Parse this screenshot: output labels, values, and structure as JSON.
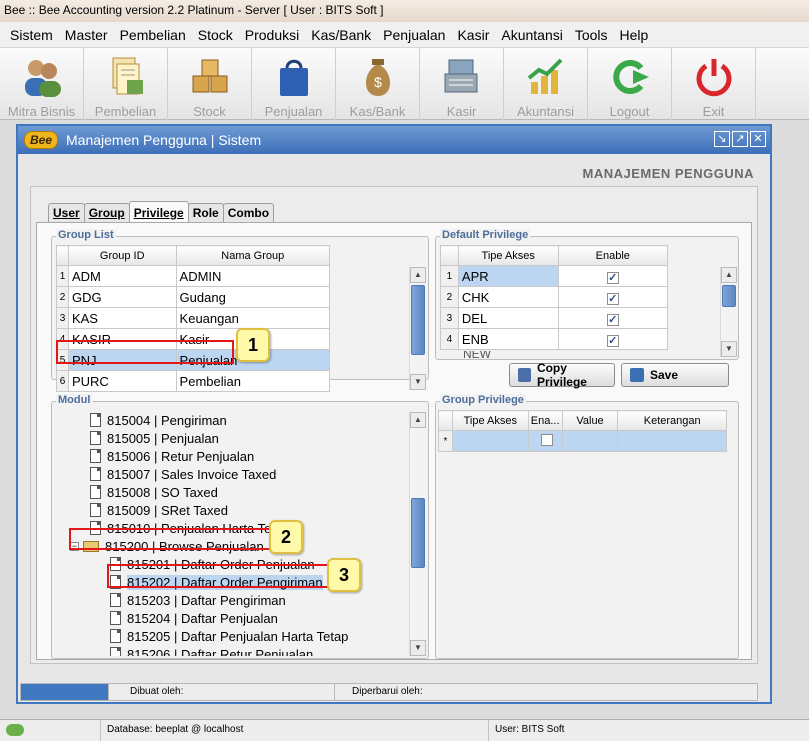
{
  "window_title": "Bee :: Bee Accounting version 2.2 Platinum - Server  [ User : BITS Soft ]",
  "menu": [
    "Sistem",
    "Master",
    "Pembelian",
    "Stock",
    "Produksi",
    "Kas/Bank",
    "Penjualan",
    "Kasir",
    "Akuntansi",
    "Tools",
    "Help"
  ],
  "toolbar": [
    {
      "label": "Mitra Bisnis",
      "icon": "partners-icon"
    },
    {
      "label": "Pembelian",
      "icon": "purchase-icon"
    },
    {
      "label": "Stock",
      "icon": "boxes-icon"
    },
    {
      "label": "Penjualan",
      "icon": "shopping-bag-icon"
    },
    {
      "label": "Kas/Bank",
      "icon": "money-bag-icon"
    },
    {
      "label": "Kasir",
      "icon": "cash-register-icon"
    },
    {
      "label": "Akuntansi",
      "icon": "growth-chart-icon"
    },
    {
      "label": "Logout",
      "icon": "logout-arrow-icon"
    },
    {
      "label": "Exit",
      "icon": "power-icon"
    }
  ],
  "child_window": {
    "logo": "Bee",
    "title": "Manajemen Pengguna | Sistem",
    "heading": "MANAJEMEN PENGGUNA",
    "tabs": [
      "User",
      "Group",
      "Privilege",
      "Role",
      "Combo"
    ],
    "active_tab": "Privilege"
  },
  "group_list": {
    "legend": "Group List",
    "columns": [
      "Group ID",
      "Nama Group"
    ],
    "rows": [
      {
        "n": "1",
        "id": "ADM",
        "name": "ADMIN"
      },
      {
        "n": "2",
        "id": "GDG",
        "name": "Gudang"
      },
      {
        "n": "3",
        "id": "KAS",
        "name": "Keuangan"
      },
      {
        "n": "4",
        "id": "KASIR",
        "name": "Kasir"
      },
      {
        "n": "5",
        "id": "PNJ",
        "name": "Penjualan"
      },
      {
        "n": "6",
        "id": "PURC",
        "name": "Pembelian"
      }
    ],
    "selected_row": 5
  },
  "default_privilege": {
    "legend": "Default Privilege",
    "columns": [
      "Tipe Akses",
      "Enable"
    ],
    "rows": [
      {
        "n": "1",
        "tipe": "APR",
        "enable": true
      },
      {
        "n": "2",
        "tipe": "CHK",
        "enable": true
      },
      {
        "n": "3",
        "tipe": "DEL",
        "enable": true
      },
      {
        "n": "4",
        "tipe": "ENB",
        "enable": true
      }
    ],
    "partial_row": "NEW"
  },
  "buttons": {
    "copy_privilege": "Copy Privilege",
    "save": "Save"
  },
  "modul": {
    "legend": "Modul",
    "nodes": [
      {
        "text": "815004 | Pengiriman",
        "level": 1
      },
      {
        "text": "815005 | Penjualan",
        "level": 1
      },
      {
        "text": "815006 | Retur Penjualan",
        "level": 1
      },
      {
        "text": "815007 | Sales Invoice Taxed",
        "level": 1
      },
      {
        "text": "815008 | SO Taxed",
        "level": 1
      },
      {
        "text": "815009 | SRet Taxed",
        "level": 1
      },
      {
        "text": "815010 | Penjualan Harta Tetap",
        "level": 1
      },
      {
        "text": "815200 | Browse Penjualan",
        "level": 0,
        "folder": true
      },
      {
        "text": "815201 | Daftar Order Penjualan",
        "level": 2
      },
      {
        "text": "815202 | Daftar Order Pengiriman",
        "level": 2,
        "selected": true
      },
      {
        "text": "815203 | Daftar Pengiriman",
        "level": 2
      },
      {
        "text": "815204 | Daftar Penjualan",
        "level": 2
      },
      {
        "text": "815205 | Daftar Penjualan Harta Tetap",
        "level": 2
      },
      {
        "text": "815206 | Daftar Retur Penjualan",
        "level": 2
      }
    ]
  },
  "group_privilege": {
    "legend": "Group Privilege",
    "columns": [
      "Tipe Akses",
      "Ena...",
      "Value",
      "Keterangan"
    ],
    "new_row_marker": "*"
  },
  "callouts": [
    "1",
    "2",
    "3"
  ],
  "status_inner": {
    "dibuat": "Dibuat oleh:",
    "diperbarui": "Diperbarui oleh:"
  },
  "status_main": {
    "database": "Database: beeplat @ localhost",
    "user": "User: BITS Soft"
  },
  "colors": {
    "accent": "#3f77c0",
    "selection": "#bcd6f2",
    "callout_fill": "#fffaaa",
    "callout_border": "#e01818"
  }
}
